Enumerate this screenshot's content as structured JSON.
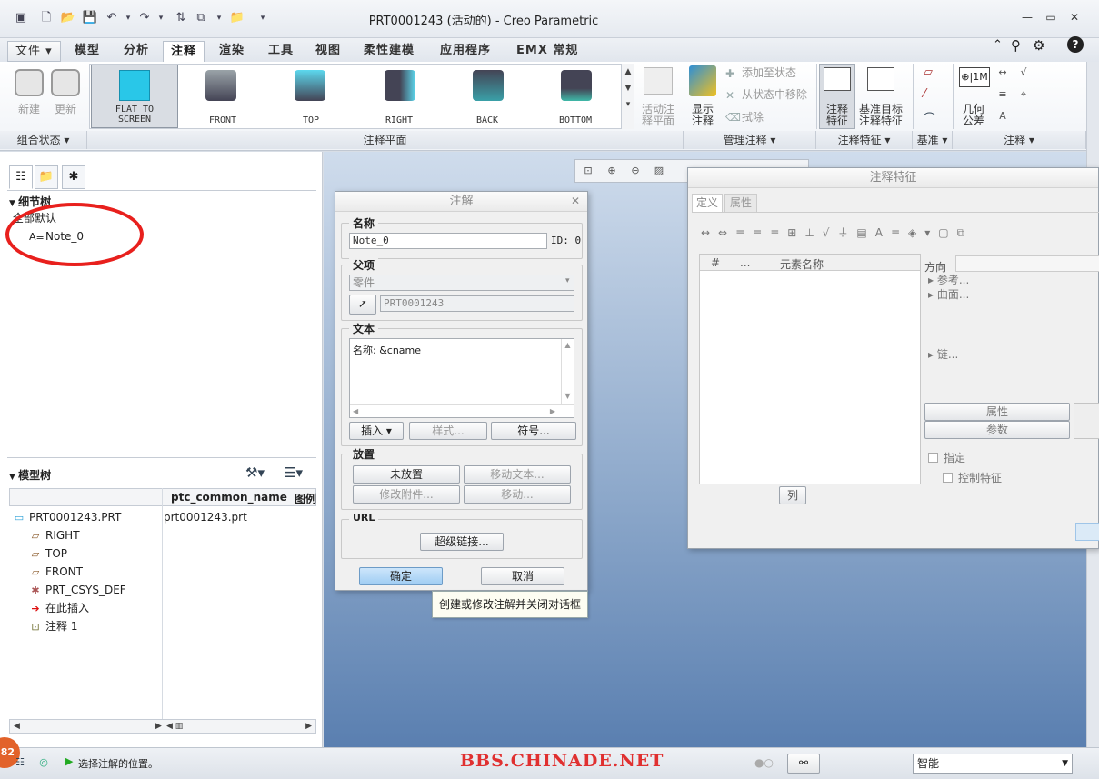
{
  "window": {
    "title": "PRT0001243 (活动的) - Creo Parametric",
    "minimize": "—",
    "restore": "▭",
    "close": "✕"
  },
  "help_icons": [
    "⌃",
    "⚲",
    "⚙",
    "?"
  ],
  "tabs": [
    {
      "label": "文件 ▾"
    },
    {
      "label": "模型"
    },
    {
      "label": "分析"
    },
    {
      "label": "注释",
      "active": true
    },
    {
      "label": "渲染"
    },
    {
      "label": "工具"
    },
    {
      "label": "视图"
    },
    {
      "label": "柔性建模"
    },
    {
      "label": "应用程序"
    },
    {
      "label": "EMX 常规"
    }
  ],
  "ribbon": {
    "combo_state": {
      "new": "新建",
      "update": "更新",
      "group": "组合状态 ▾"
    },
    "planes": {
      "items": [
        "FLAT TO SCREEN",
        "FRONT",
        "TOP",
        "RIGHT",
        "BACK",
        "BOTTOM"
      ],
      "group": "注释平面",
      "active_plane": "活动注\n释平面"
    },
    "manage": {
      "show": "显示\n注释",
      "add_to_state": "添加至状态",
      "remove_from_state": "从状态中移除",
      "erase": "拭除",
      "group": "管理注释 ▾"
    },
    "feature": {
      "annotation_feature": "注释\n特征",
      "datum_target": "基准目标\n注释特征",
      "group": "注释特征 ▾"
    },
    "datum": {
      "group": "基准 ▾"
    },
    "annotation": {
      "geo_tol": "几何\n公差",
      "group": "注释 ▾"
    }
  },
  "detail_tree": {
    "title": "细节树",
    "root": "全部默认",
    "items": [
      "Note_0"
    ]
  },
  "model_tree": {
    "title": "模型树",
    "col_header": "ptc_common_name",
    "col_header2": "图例",
    "rows": [
      {
        "name": "PRT0001243.PRT",
        "value": "prt0001243.prt",
        "icon": "▭"
      },
      {
        "name": "RIGHT",
        "value": "",
        "icon": "▱"
      },
      {
        "name": "TOP",
        "value": "",
        "icon": "▱"
      },
      {
        "name": "FRONT",
        "value": "",
        "icon": "▱"
      },
      {
        "name": "PRT_CSYS_DEF",
        "value": "",
        "icon": "✱"
      },
      {
        "name": "在此插入",
        "value": "",
        "icon": "➔"
      },
      {
        "name": "注释 1",
        "value": "",
        "icon": "⊡"
      }
    ]
  },
  "note_dialog": {
    "title": "注解",
    "name_legend": "名称",
    "name_value": "Note_0",
    "id_label": "ID: 0",
    "parent_legend": "父项",
    "parent_type": "零件",
    "parent_value": "PRT0001243",
    "text_legend": "文本",
    "text_value": "名称: &cname",
    "insert_btn": "插入 ▾",
    "style_btn": "样式...",
    "symbol_btn": "符号...",
    "place_legend": "放置",
    "not_placed_btn": "未放置",
    "move_text_btn": "移动文本...",
    "modify_attach_btn": "修改附件...",
    "move_btn": "移动...",
    "url_legend": "URL",
    "hyperlink_btn": "超级链接...",
    "ok_btn": "确定",
    "cancel_btn": "取消",
    "tooltip": "创建或修改注解并关闭对话框"
  },
  "feature_dialog": {
    "title": "注释特征",
    "tab_definition": "定义",
    "tab_properties": "属性",
    "table_headers": [
      "#",
      "...",
      "元素名称"
    ],
    "direction_label": "方向",
    "reference": "参考...",
    "surface": "曲面...",
    "chain": "链...",
    "attr_btn": "属性",
    "param_btn": "参数",
    "specify": "指定",
    "control_feature": "控制特征",
    "column_btn": "列"
  },
  "statusbar": {
    "message": "选择注解的位置。",
    "watermark": "BBS.CHINADE.NET",
    "filter": "智能",
    "badge": "82"
  },
  "colors": {
    "accent": "#3a78c2",
    "red_annotation": "#e8201d",
    "watermark": "#e03030"
  }
}
